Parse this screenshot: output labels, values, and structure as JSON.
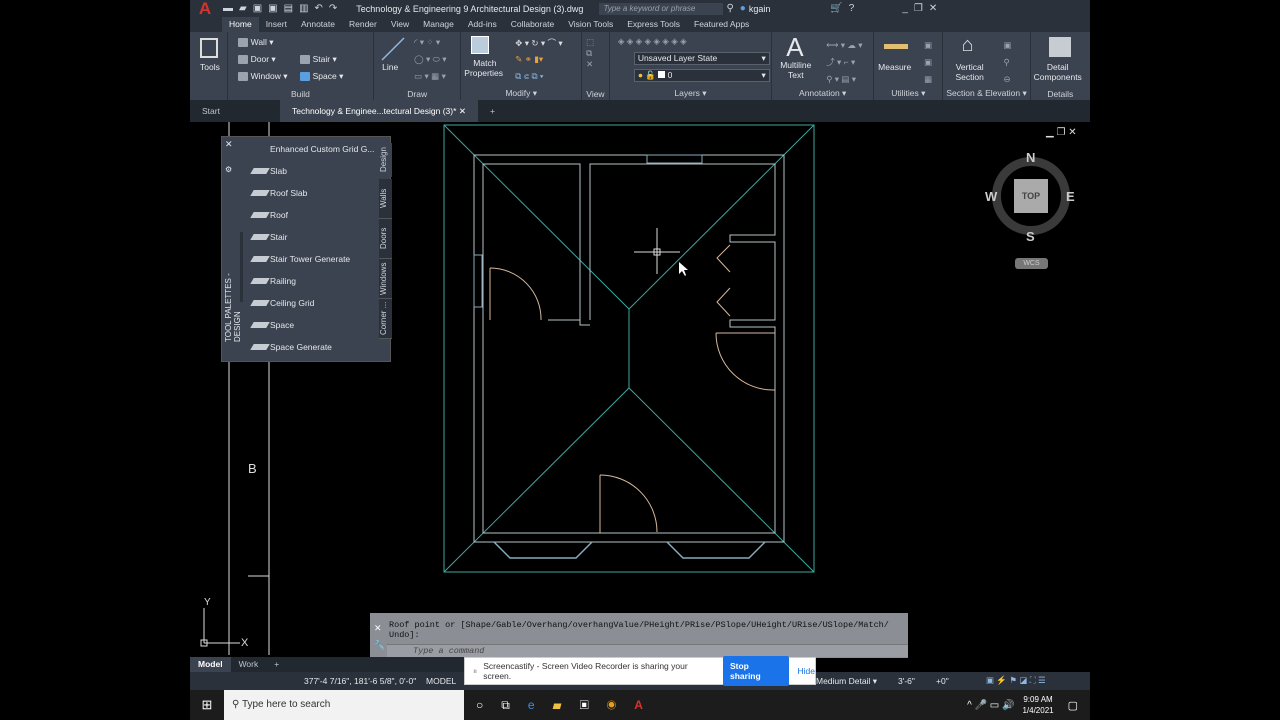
{
  "titlebar": {
    "logo": "A",
    "title": "Technology & Engineering 9 Architectural Design (3).dwg",
    "search_placeholder": "Type a keyword or phrase",
    "user": "kgain",
    "quick_access_icons": [
      "new-icon",
      "open-icon",
      "save-icon",
      "saveas-icon",
      "plot-icon",
      "print-icon",
      "undo-icon",
      "redo-icon"
    ]
  },
  "menu_tabs": [
    "Home",
    "Insert",
    "Annotate",
    "Render",
    "View",
    "Manage",
    "Add-ins",
    "Collaborate",
    "Vision Tools",
    "Express Tools",
    "Featured Apps"
  ],
  "ribbon": {
    "tools": "Tools",
    "build": {
      "label": "Build",
      "items": [
        "Wall",
        "Door",
        "Window",
        "Stair",
        "Space"
      ]
    },
    "draw": {
      "label": "Draw",
      "line": "Line"
    },
    "modify": {
      "label": "Modify",
      "match": "Match",
      "properties": "Properties"
    },
    "view": {
      "label": "View"
    },
    "layers": {
      "label": "Layers",
      "layer_state": "Unsaved Layer State",
      "layer": "0"
    },
    "annotation": {
      "label": "Annotation",
      "multiline": "Multiline",
      "text": "Text"
    },
    "utilities": {
      "label": "Utilities",
      "measure": "Measure"
    },
    "section": {
      "label": "Section & Elevation",
      "vertical": "Vertical",
      "section": "Section"
    },
    "details": {
      "label": "Details",
      "detail": "Detail",
      "components": "Components"
    }
  },
  "doc_tabs": {
    "start": "Start",
    "active": "Technology & Enginee...tectural Design (3)*"
  },
  "palette": {
    "title": "TOOL PALETTES - DESIGN",
    "items": [
      "Enhanced Custom Grid G...",
      "Slab",
      "Roof Slab",
      "Roof",
      "Stair",
      "Stair Tower Generate",
      "Railing",
      "Ceiling Grid",
      "Space",
      "Space Generate"
    ],
    "tabs": [
      "Design",
      "Walls",
      "Doors",
      "Windows",
      "Corner ..."
    ]
  },
  "viewcube": {
    "n": "N",
    "s": "S",
    "e": "E",
    "w": "W",
    "face": "TOP",
    "ucs": "WCS"
  },
  "drawing": {
    "grid_label": "B",
    "ucs_x": "X",
    "ucs_y": "Y",
    "colors": {
      "roof": "#3fa9a0",
      "wall": "#b9c3c8",
      "door": "#d8b89a"
    }
  },
  "command": {
    "prompt": "Roof point or [Shape/Gable/Overhang/overhangValue/PHeight/PRise/PSlope/UHeight/URise/USlope/Match/",
    "prompt2": "Undo]:",
    "placeholder": "Type a command"
  },
  "layout_tabs": [
    "Model",
    "Work"
  ],
  "status": {
    "coords": "377'-4 7/16\", 181'-6 5/8\", 0'-0\"",
    "model": "MODEL",
    "detail": "Medium Detail",
    "elevation": "3'-6\"",
    "offset": "+0\""
  },
  "banner": {
    "text": "Screencastify - Screen Video Recorder is sharing your screen.",
    "stop": "Stop sharing",
    "hide": "Hide",
    "stop_color": "#1a73e8"
  },
  "taskbar": {
    "search": "Type here to search",
    "time": "9:09 AM",
    "date": "1/4/2021"
  }
}
